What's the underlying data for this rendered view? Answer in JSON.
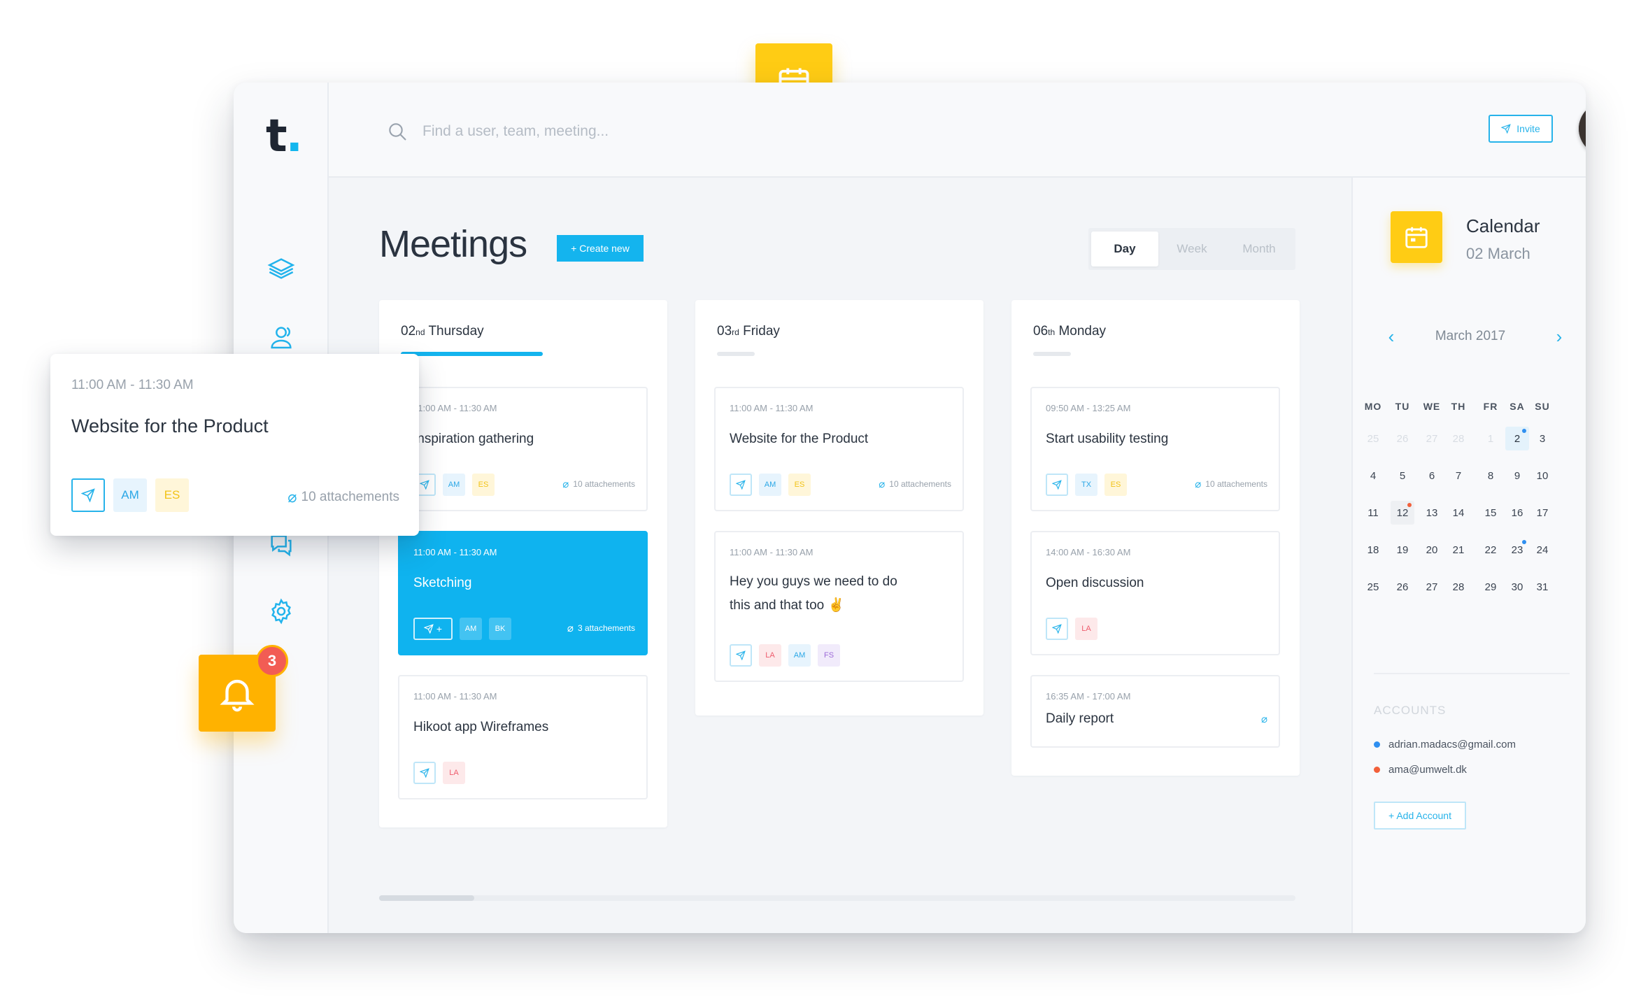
{
  "app": {
    "logo_letter": "t",
    "logo_dot": "."
  },
  "search": {
    "placeholder": "Find a user, team, meeting..."
  },
  "header": {
    "invite_label": "Invite"
  },
  "main": {
    "title": "Meetings",
    "create_label": "+ Create new",
    "views": [
      "Day",
      "Week",
      "Month"
    ],
    "active_view": "Day"
  },
  "columns": [
    {
      "day_num": "02",
      "day_suffix": "nd",
      "day_name": "Thursday",
      "cards": [
        {
          "time": "11:00 AM - 11:30 AM",
          "title": "Inspiration gathering",
          "tags": [
            "AM",
            "ES"
          ],
          "attachments": "10 attachements"
        },
        {
          "time": "11:00 AM - 11:30 AM",
          "title": "Sketching",
          "tags": [
            "AM",
            "BK"
          ],
          "attachments": "3 attachements",
          "share_extra": "+"
        },
        {
          "time": "11:00 AM - 11:30 AM",
          "title": "Hikoot app Wireframes",
          "tags": [
            "LA"
          ]
        }
      ]
    },
    {
      "day_num": "03",
      "day_suffix": "rd",
      "day_name": "Friday",
      "cards": [
        {
          "time": "11:00 AM - 11:30 AM",
          "title": "Website for the Product",
          "tags": [
            "AM",
            "ES"
          ],
          "attachments": "10 attachements"
        },
        {
          "time": "11:00 AM - 11:30 AM",
          "title": "Hey you guys we need to do this and that too ✌",
          "tags": [
            "LA",
            "AM",
            "FS"
          ]
        }
      ]
    },
    {
      "day_num": "06",
      "day_suffix": "th",
      "day_name": "Monday",
      "cards": [
        {
          "time": "09:50 AM - 13:25 AM",
          "title": "Start usability testing",
          "tags": [
            "TX",
            "ES"
          ],
          "attachments": "10 attachements"
        },
        {
          "time": "14:00 AM - 16:30 AM",
          "title": "Open discussion",
          "tags": [
            "LA"
          ]
        },
        {
          "time": "16:35 AM - 17:00 AM",
          "title": "Daily report",
          "tags": []
        }
      ]
    }
  ],
  "calendar": {
    "title": "Calendar",
    "subtitle": "02 March",
    "month": "March 2017",
    "weekdays": [
      "MO",
      "TU",
      "WE",
      "TH",
      "FR",
      "SA",
      "SU"
    ],
    "weeks": [
      [
        "25",
        "26",
        "27",
        "28",
        "1",
        "2",
        "3"
      ],
      [
        "4",
        "5",
        "6",
        "7",
        "8",
        "9",
        "10"
      ],
      [
        "11",
        "12",
        "13",
        "14",
        "15",
        "16",
        "17"
      ],
      [
        "18",
        "19",
        "20",
        "21",
        "22",
        "23",
        "24"
      ],
      [
        "25",
        "26",
        "27",
        "28",
        "29",
        "30",
        "31"
      ]
    ],
    "muted_first_row_count": 5,
    "today": "2",
    "marked": [
      "12",
      "23"
    ]
  },
  "accounts": {
    "heading": "ACCOUNTS",
    "items": [
      {
        "email": "adrian.madacs@gmail.com",
        "color": "#2f8ff0"
      },
      {
        "email": "ama@umwelt.dk",
        "color": "#f2603a"
      }
    ],
    "add_label": "+ Add Account"
  },
  "float_card": {
    "time": "11:00 AM - 11:30 AM",
    "title": "Website for the Product",
    "tags": [
      "AM",
      "ES"
    ],
    "attachments": "10 attachements"
  },
  "notifications": {
    "count": "3"
  },
  "colors": {
    "accent": "#14b4ee",
    "yellow": "#ffcc14",
    "orange": "#ffb200",
    "badge": "#f25c54"
  }
}
